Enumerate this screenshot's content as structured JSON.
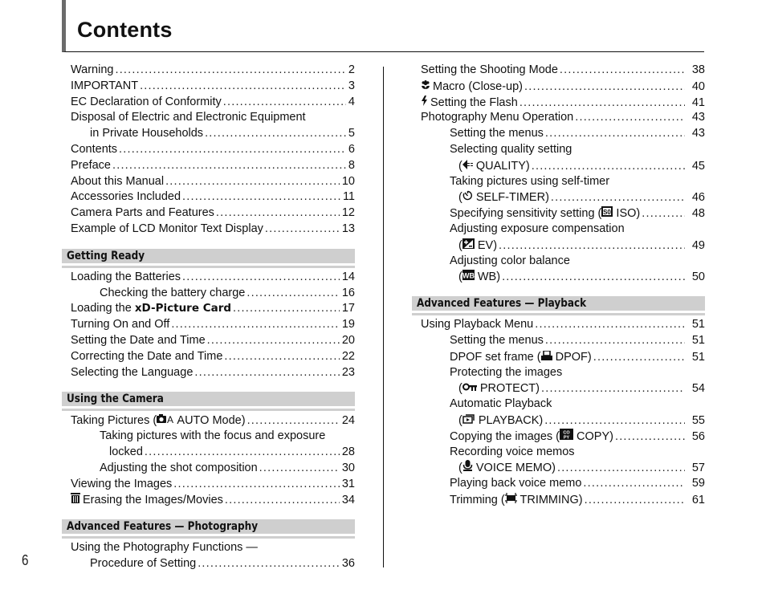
{
  "page": {
    "title": "Contents",
    "page_number": "6"
  },
  "left_column": {
    "intro": [
      {
        "label": "Warning",
        "page": "2"
      },
      {
        "label": "IMPORTANT",
        "page": "3"
      },
      {
        "label": "EC Declaration of Conformity",
        "page": "4"
      },
      {
        "label": "Disposal of Electric and Electronic Equipment",
        "page": ""
      },
      {
        "label": "in Private Households",
        "page": "5"
      },
      {
        "label": "Contents",
        "page": "6"
      },
      {
        "label": "Preface",
        "page": "8"
      },
      {
        "label": "About this Manual",
        "page": "10"
      },
      {
        "label": "Accessories Included",
        "page": "11"
      },
      {
        "label": "Camera Parts and Features",
        "page": "12"
      },
      {
        "label": "Example of LCD Monitor Text Display",
        "page": "13"
      }
    ],
    "getting_ready": {
      "heading": "Getting Ready",
      "entries": [
        {
          "label": "Loading the Batteries",
          "page": "14"
        },
        {
          "label": "Checking the battery charge",
          "page": "16"
        },
        {
          "label": "Loading the",
          "label_bold": "xD-Picture Card",
          "page": "17"
        },
        {
          "label": "Turning On and Off",
          "page": "19"
        },
        {
          "label": "Setting the Date and Time",
          "page": "20"
        },
        {
          "label": "Correcting the Date and Time",
          "page": "22"
        },
        {
          "label": "Selecting the Language",
          "page": "23"
        }
      ]
    },
    "using_camera": {
      "heading": "Using the Camera",
      "entries": [
        {
          "label_pre": "Taking Pictures (",
          "icon": "camera-auto-icon",
          "icon_glyph": "◘Å",
          "label": " AUTO Mode)",
          "page": "24"
        },
        {
          "label": "Taking pictures with the focus and exposure",
          "page": ""
        },
        {
          "label": "locked",
          "page": "28"
        },
        {
          "label": "Adjusting the shot composition",
          "page": "30"
        },
        {
          "label": "Viewing the Images",
          "page": "31"
        },
        {
          "icon": "trash-icon",
          "icon_glyph": "🗑",
          "label": "Erasing the Images/Movies",
          "page": "34"
        }
      ]
    },
    "adv_photography": {
      "heading": "Advanced Features — Photography",
      "entries": [
        {
          "label": "Using the Photography Functions —",
          "page": ""
        },
        {
          "label": "Procedure of Setting",
          "page": "36"
        }
      ]
    }
  },
  "right_column": {
    "photography_cont": [
      {
        "label": "Setting the Shooting Mode",
        "page": "38"
      },
      {
        "icon": "macro-icon",
        "icon_glyph": "✿",
        "label": "Macro (Close-up)",
        "page": "40"
      },
      {
        "icon": "flash-icon",
        "icon_glyph": "ϟ",
        "label": "Setting the Flash",
        "page": "41"
      },
      {
        "label": "Photography Menu Operation",
        "page": "43"
      },
      {
        "label": "Setting the menus",
        "page": "43"
      },
      {
        "label": "Selecting quality setting",
        "page": ""
      },
      {
        "label_pre": "(",
        "icon": "quality-icon",
        "icon_glyph": "⇚",
        "label": " QUALITY)",
        "page": "45"
      },
      {
        "label": "Taking pictures using self-timer",
        "page": ""
      },
      {
        "label_pre": "(",
        "icon": "self-timer-icon",
        "icon_glyph": "⏲",
        "label": " SELF-TIMER)",
        "page": "46"
      },
      {
        "label_pre": "Specifying sensitivity setting (",
        "icon": "iso-icon",
        "icon_glyph": "ISO",
        "label": " ISO)",
        "page": "48"
      },
      {
        "label": "Adjusting exposure compensation",
        "page": ""
      },
      {
        "label_pre": "(",
        "icon": "ev-icon",
        "icon_glyph": "±",
        "label": " EV)",
        "page": "49"
      },
      {
        "label": "Adjusting color balance",
        "page": ""
      },
      {
        "label_pre": "(",
        "icon": "wb-icon",
        "icon_glyph": "WB",
        "label": " WB)",
        "page": "50"
      }
    ],
    "adv_playback": {
      "heading": "Advanced Features — Playback",
      "entries": [
        {
          "label": "Using Playback Menu",
          "page": "51"
        },
        {
          "label": "Setting the menus",
          "page": "51"
        },
        {
          "label_pre": "DPOF set frame (",
          "icon": "print-icon",
          "icon_glyph": "⎙",
          "label": " DPOF)",
          "page": "51"
        },
        {
          "label": "Protecting the images",
          "page": ""
        },
        {
          "label_pre": "(",
          "icon": "key-icon",
          "icon_glyph": "O‑π",
          "label": " PROTECT)",
          "page": "54"
        },
        {
          "label": "Automatic Playback",
          "page": ""
        },
        {
          "label_pre": "(",
          "icon": "playback-icon",
          "icon_glyph": "⧉",
          "label": " PLAYBACK)",
          "page": "55"
        },
        {
          "label_pre": "Copying the images (",
          "icon": "copy-icon",
          "icon_glyph": "CPY",
          "label": " COPY)",
          "page": "56"
        },
        {
          "label": "Recording voice memos",
          "page": ""
        },
        {
          "label_pre": "(",
          "icon": "microphone-icon",
          "icon_glyph": "🎙",
          "label": " VOICE MEMO)",
          "page": "57"
        },
        {
          "label": "Playing back voice memo",
          "page": "59"
        },
        {
          "label_pre": "Trimming (",
          "icon": "trimming-icon",
          "icon_glyph": "⌗",
          "label": " TRIMMING)",
          "page": "61"
        }
      ]
    }
  }
}
